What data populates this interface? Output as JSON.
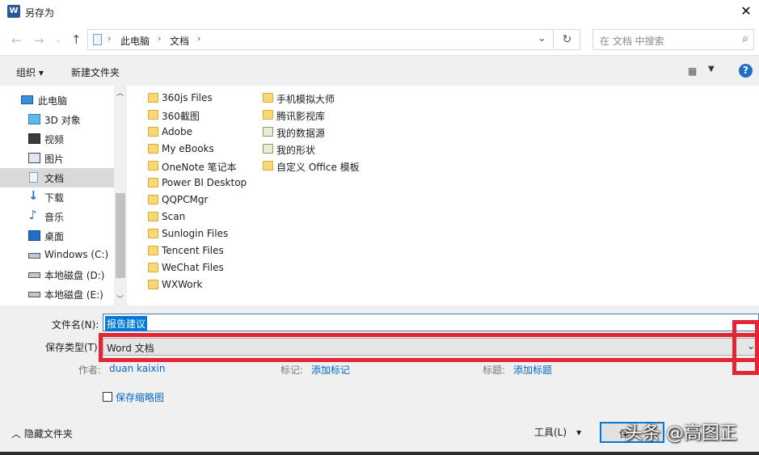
{
  "window": {
    "title": "另存为",
    "app_icon": "word-icon",
    "close_glyph": "✕"
  },
  "address": {
    "segments": [
      "此电脑",
      "文档"
    ],
    "search_placeholder": "在 文档 中搜索"
  },
  "toolbar": {
    "organize": "组织 ▾",
    "new_folder": "新建文件夹",
    "help": "?"
  },
  "sidebar": {
    "items": [
      {
        "label": "此电脑",
        "icon": "pc-icon"
      },
      {
        "label": "3D 对象",
        "icon": "3d-objects-icon"
      },
      {
        "label": "视频",
        "icon": "video-icon"
      },
      {
        "label": "图片",
        "icon": "pictures-icon"
      },
      {
        "label": "文档",
        "icon": "documents-icon",
        "selected": true
      },
      {
        "label": "下载",
        "icon": "download-icon"
      },
      {
        "label": "音乐",
        "icon": "music-icon"
      },
      {
        "label": "桌面",
        "icon": "desktop-icon"
      },
      {
        "label": "Windows (C:)",
        "icon": "drive-icon"
      },
      {
        "label": "本地磁盘 (D:)",
        "icon": "drive-icon"
      },
      {
        "label": "本地磁盘 (E:)",
        "icon": "drive-icon"
      }
    ]
  },
  "files": {
    "col1": [
      "360js Files",
      "360截图",
      "Adobe",
      "My eBooks",
      "OneNote 笔记本",
      "Power BI Desktop",
      "QQPCMgr",
      "Scan",
      "Sunlogin Files",
      "Tencent Files",
      "WeChat Files",
      "WXWork"
    ],
    "col2": [
      "手机模拟大师",
      "腾讯影视库",
      "我的数据源",
      "我的形状",
      "自定义 Office 模板"
    ]
  },
  "form": {
    "filename_label": "文件名(N):",
    "filename_value": "报告建议",
    "type_label": "保存类型(T):",
    "type_value": "Word 文档",
    "author_label": "作者:",
    "author_value": "duan kaixin",
    "tags_label": "标记:",
    "tags_link": "添加标记",
    "title_label": "标题:",
    "title_link": "添加标题",
    "thumbnail_label": "保存缩略图",
    "hide_folders": "隐藏文件夹",
    "tools": "工具(L)",
    "save": "保"
  },
  "watermark": "头条 @高图正",
  "colors": {
    "highlight": "#e32636",
    "accent": "#0078d7",
    "link": "#0066cc"
  }
}
